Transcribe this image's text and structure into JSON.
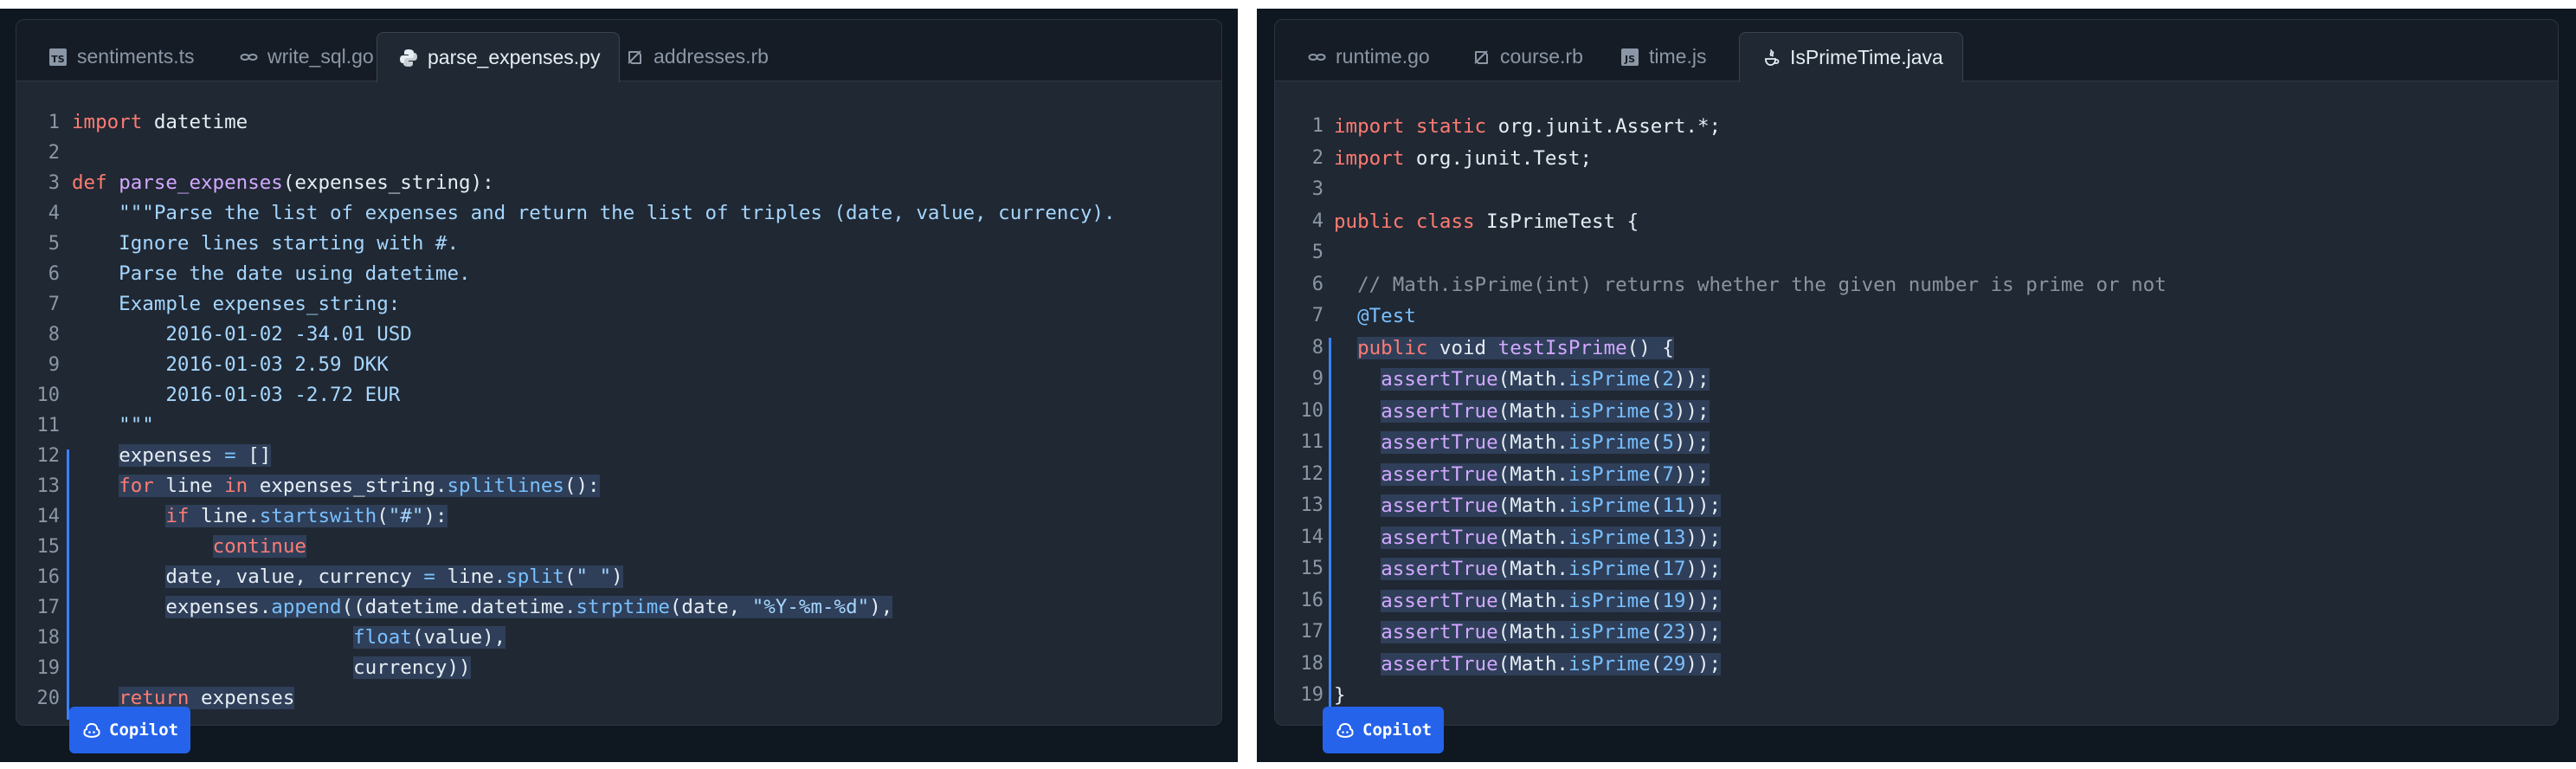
{
  "left": {
    "tabs": [
      {
        "label": "sentiments.ts",
        "icon": "typescript-icon"
      },
      {
        "label": "write_sql.go",
        "icon": "go-icon"
      },
      {
        "label": "parse_expenses.py",
        "icon": "python-icon",
        "active": true
      },
      {
        "label": "addresses.rb",
        "icon": "ruby-icon"
      }
    ],
    "line_numbers": [
      "1",
      "2",
      "3",
      "4",
      "5",
      "6",
      "7",
      "8",
      "9",
      "10",
      "11",
      "12",
      "13",
      "14",
      "15",
      "16",
      "17",
      "18",
      "19",
      "20"
    ],
    "code": {
      "l1_kw": "import",
      "l1_rest": " datetime",
      "l3_kw": "def",
      "l3_fn": "parse_expenses",
      "l3_rest": "(expenses_string):",
      "l4": "    \"\"\"Parse the list of expenses and return the list of triples (date, value, currency).",
      "l5": "    Ignore lines starting with #.",
      "l6": "    Parse the date using datetime.",
      "l7": "    Example expenses_string:",
      "l8": "        2016-01-02 -34.01 USD",
      "l9": "        2016-01-03 2.59 DKK",
      "l10": "        2016-01-03 -2.72 EUR",
      "l11": "    \"\"\"",
      "l12_a": "expenses ",
      "l12_op": "=",
      "l12_b": " []",
      "l13_kw": "for",
      "l13_a": " line ",
      "l13_kw2": "in",
      "l13_b": " expenses_string.",
      "l13_fn": "splitlines",
      "l13_c": "():",
      "l14_kw": "if",
      "l14_a": " line.",
      "l14_fn": "startswith",
      "l14_b": "(",
      "l14_str": "\"#\"",
      "l14_c": "):",
      "l15_kw": "continue",
      "l16_a": "date, value, currency ",
      "l16_op": "=",
      "l16_b": " line.",
      "l16_fn": "split",
      "l16_c": "(",
      "l16_str": "\" \"",
      "l16_d": ")",
      "l17_a": "expenses.",
      "l17_fn": "append",
      "l17_b": "((datetime.datetime.",
      "l17_fn2": "strptime",
      "l17_c": "(date, ",
      "l17_str": "\"%Y-%m-%d\"",
      "l17_d": "),",
      "l18_bi": "float",
      "l18_a": "(value),",
      "l19_a": "currency))",
      "l20_kw": "return",
      "l20_a": " expenses"
    },
    "copilot_label": "Copilot"
  },
  "right": {
    "tabs": [
      {
        "label": "runtime.go",
        "icon": "go-icon"
      },
      {
        "label": "course.rb",
        "icon": "ruby-icon"
      },
      {
        "label": "time.js",
        "icon": "javascript-icon"
      },
      {
        "label": "IsPrimeTime.java",
        "icon": "java-icon",
        "active": true
      }
    ],
    "line_numbers": [
      "1",
      "2",
      "3",
      "4",
      "5",
      "6",
      "7",
      "8",
      "9",
      "10",
      "11",
      "12",
      "13",
      "14",
      "15",
      "16",
      "17",
      "18",
      "19"
    ],
    "code": {
      "l1_kw": "import static",
      "l1_a": " org.junit.Assert.*;",
      "l2_kw": "import",
      "l2_a": " org.junit.Test;",
      "l4_kw": "public class",
      "l4_a": " IsPrimeTest {",
      "l6": "// Math.isPrime(int) returns whether the given number is prime or not",
      "l7": "@Test",
      "l8_kw": "public",
      "l8_a": " void ",
      "l8_fn": "testIsPrime",
      "l8_b": "() {",
      "assert_fn": "assertTrue",
      "assert_obj": "(Math.",
      "assert_method": "isPrime",
      "assert_nums": [
        "2",
        "3",
        "5",
        "7",
        "11",
        "13",
        "17",
        "19",
        "23",
        "29"
      ],
      "assert_end": "));",
      "l19": "}"
    },
    "copilot_label": "Copilot"
  }
}
